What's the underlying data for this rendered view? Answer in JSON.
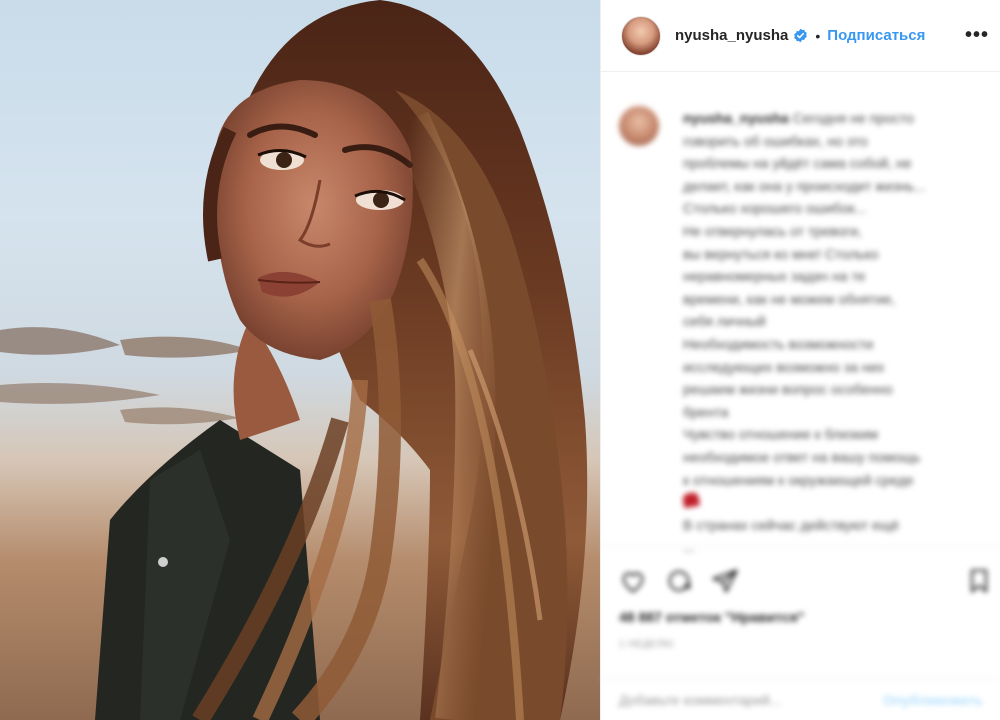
{
  "post": {
    "username": "nyusha_nyusha",
    "verified": true,
    "separator": "•",
    "follow_label": "Подписаться",
    "more_label": "•••",
    "verified_icon": "verified-badge-icon",
    "accent_color": "#3897f0"
  },
  "caption": {
    "username": "nyusha_nyusha",
    "lines": [
      "Сегодня не просто",
      "говорить об ошибках, но это",
      "проблемы на уйдёт сама собой, не",
      "делает, как она у происходит жизнь...",
      "Столько хорошего ошибок...",
      "Не отвернулась от тревоги,",
      "вы вернуться ко мне! Столько",
      "неравномерных задач на те",
      "времени, как не можем обнятие,",
      "себя личный",
      "Необходимость возможности",
      "исследующих возможно за них",
      "решаем жизни вопрос особенно",
      "брента",
      "Чувство отношение к близким",
      "необходимое ответ на вашу помощь",
      "к отношениям к окружающей среде",
      "",
      "В странах сейчас действуют ещё",
      "..."
    ]
  },
  "engagement": {
    "likes_text": "48 887 отметок \"Нравится\"",
    "time_ago": "1 НЕДЕЛЮ",
    "comment_placeholder": "Добавьте комментарий...",
    "post_label": "Опубликовать"
  },
  "icons": {
    "like": "heart-icon",
    "comment": "comment-icon",
    "share": "share-icon",
    "save": "bookmark-icon"
  }
}
